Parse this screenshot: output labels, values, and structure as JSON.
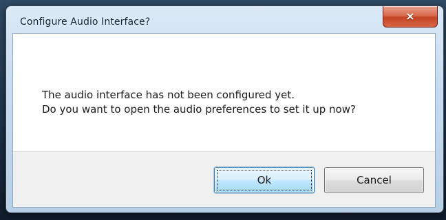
{
  "window": {
    "title": "Configure Audio Interface?",
    "close_icon": "×"
  },
  "dialog": {
    "message_line_1": "The audio interface has not been configured yet.",
    "message_line_2": "Do you want to open the audio preferences to set it up now?"
  },
  "buttons": {
    "ok_label": "Ok",
    "cancel_label": "Cancel"
  },
  "colors": {
    "title_text": "#10253a",
    "close_button": "#d86b4c",
    "ok_border": "#3c7fb1"
  },
  "icons": {
    "close": "close-icon"
  }
}
